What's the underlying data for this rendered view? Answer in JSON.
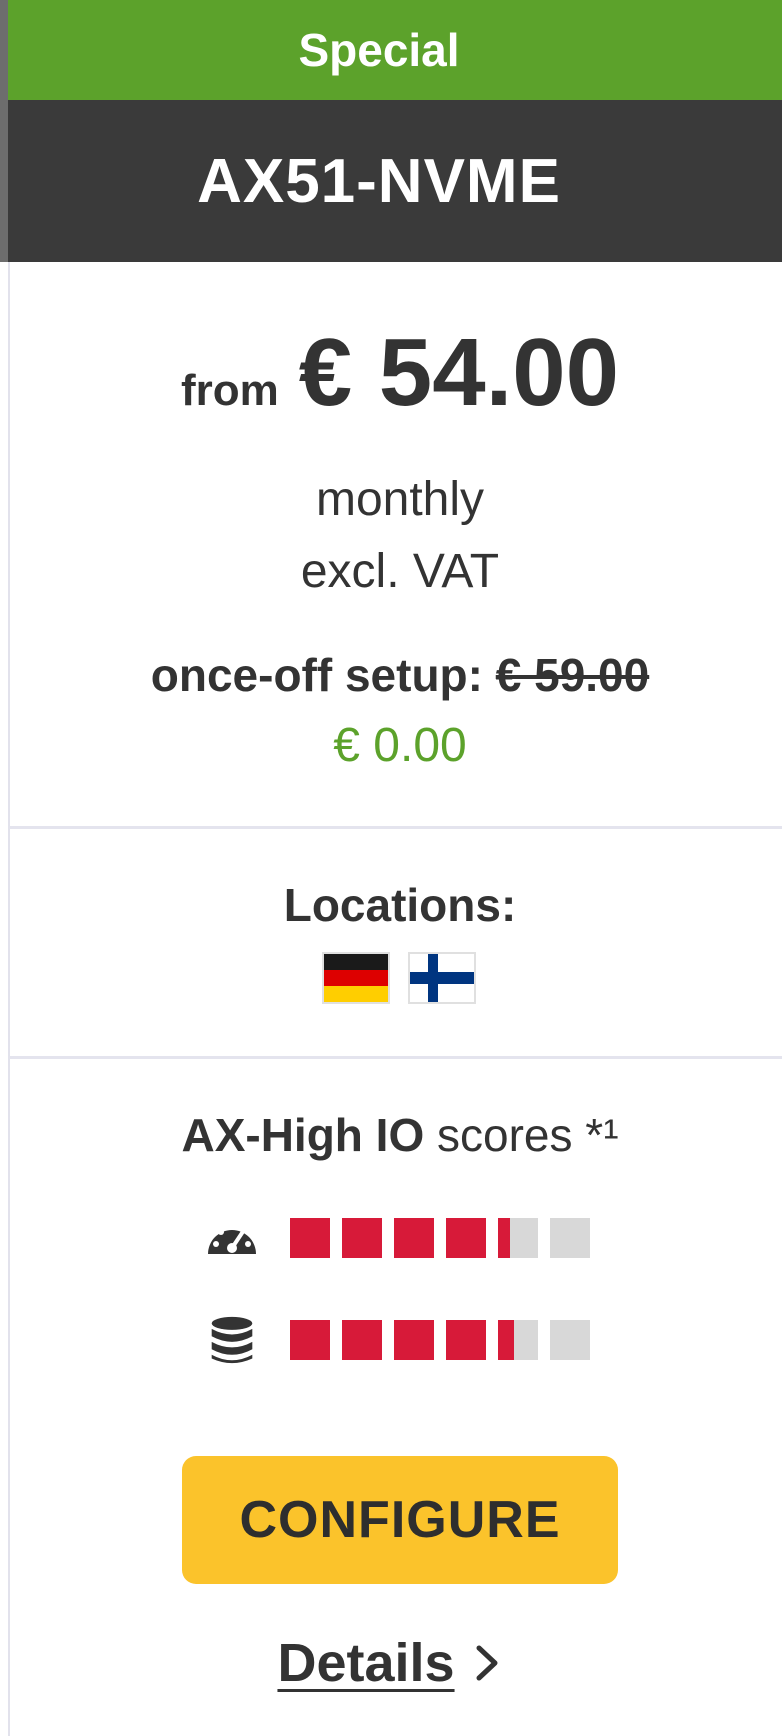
{
  "ribbon": {
    "label": "Special"
  },
  "product": {
    "name": "AX51-NVME"
  },
  "pricing": {
    "from_label": "from",
    "amount": "€ 54.00",
    "period": "monthly",
    "tax_note": "excl. VAT",
    "setup_label": "once-off setup:",
    "setup_old": "€ 59.00",
    "setup_new": "€ 0.00",
    "setup_new_color": "#5ca22b"
  },
  "locations": {
    "label": "Locations:",
    "flags": [
      "germany-flag",
      "finland-flag"
    ]
  },
  "scores": {
    "title_strong": "AX-High IO",
    "title_rest": " scores *¹",
    "rows": [
      {
        "icon": "speedometer-icon",
        "value": 4.3,
        "max": 6
      },
      {
        "icon": "database-icon",
        "value": 4.4,
        "max": 6
      }
    ],
    "fill_color": "#d71a39",
    "empty_color": "#d8d8d8"
  },
  "actions": {
    "configure_label": "CONFIGURE",
    "details_label": "Details"
  }
}
